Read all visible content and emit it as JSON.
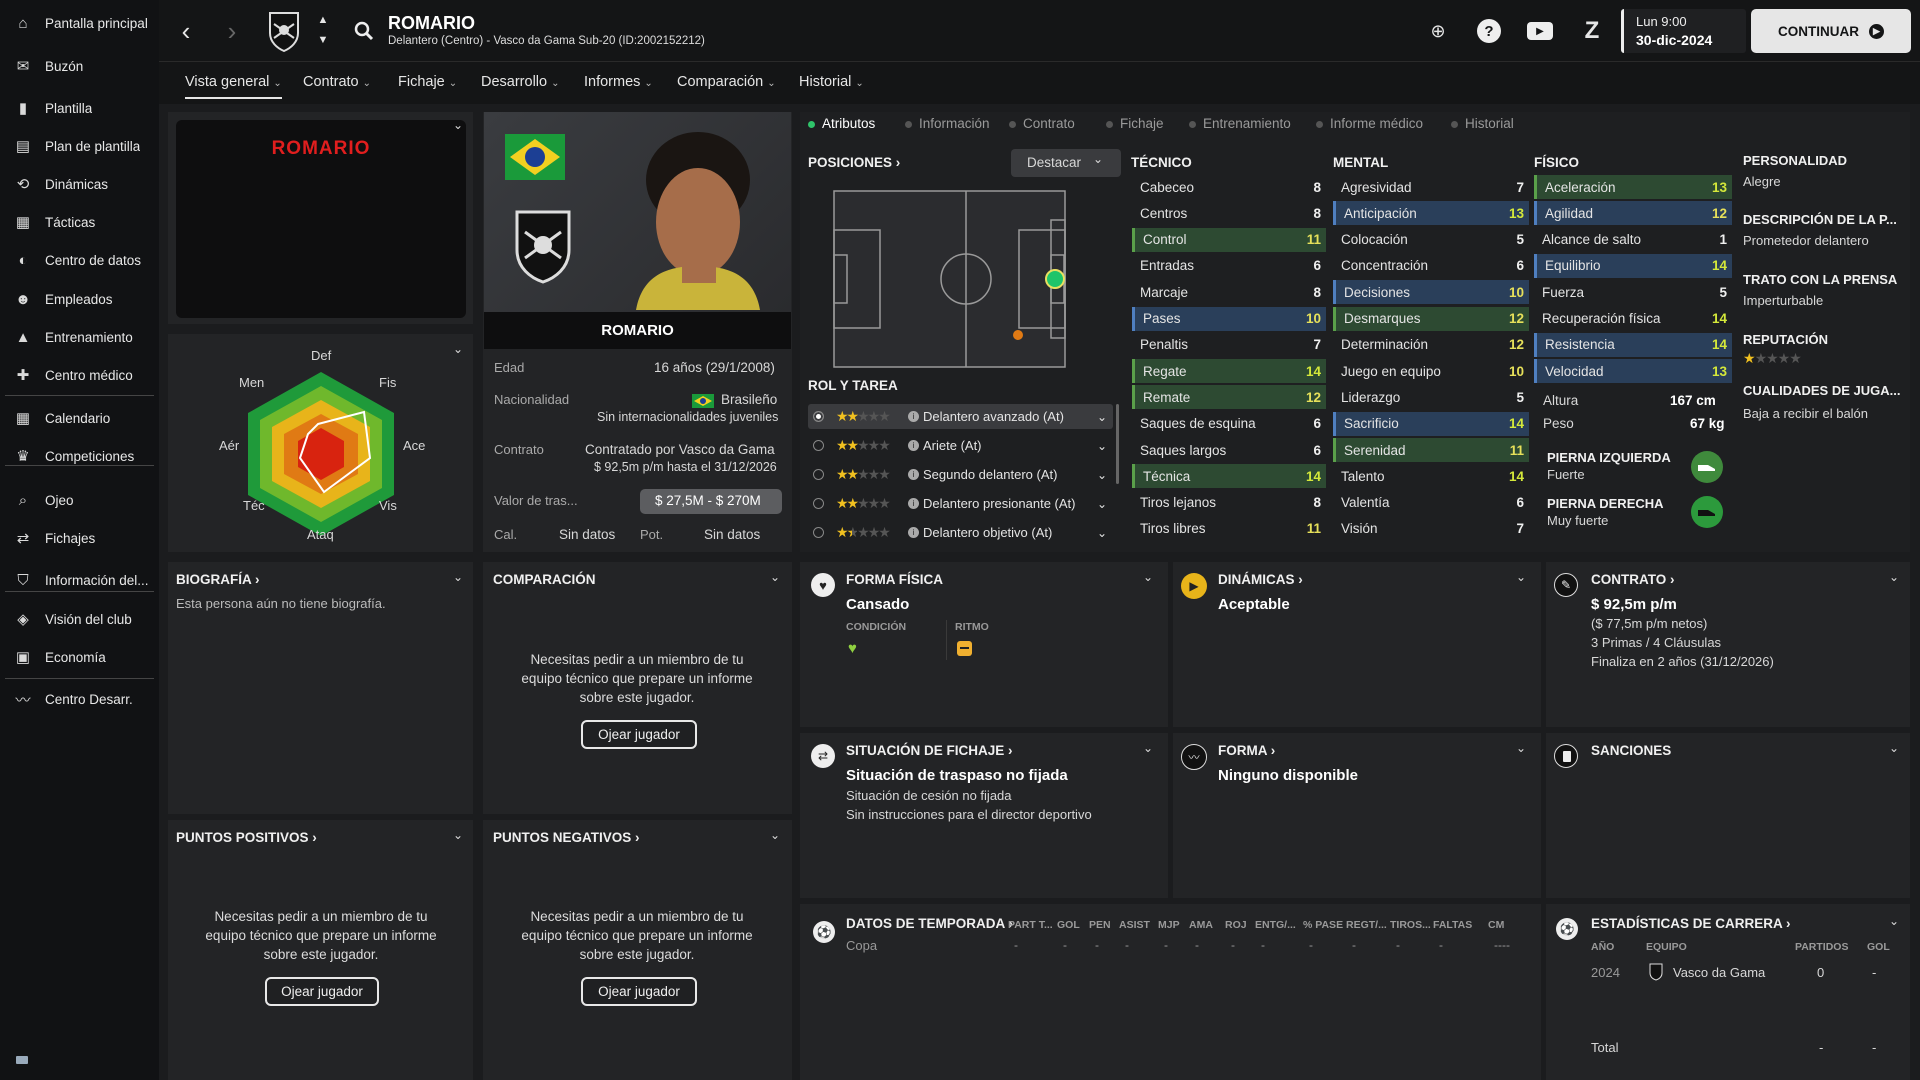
{
  "sidebar": {
    "items": [
      {
        "label": "Pantalla principal",
        "icon": "home-icon"
      },
      {
        "label": "Buzón",
        "icon": "inbox-icon"
      },
      {
        "label": "Plantilla",
        "icon": "squad-icon"
      },
      {
        "label": "Plan de plantilla",
        "icon": "clipboard-icon"
      },
      {
        "label": "Dinámicas",
        "icon": "dynamics-icon"
      },
      {
        "label": "Tácticas",
        "icon": "tactics-icon"
      },
      {
        "label": "Centro de datos",
        "icon": "data-icon"
      },
      {
        "label": "Empleados",
        "icon": "staff-icon"
      },
      {
        "label": "Entrenamiento",
        "icon": "training-icon"
      },
      {
        "label": "Centro médico",
        "icon": "medical-icon"
      },
      {
        "label": "Calendario",
        "icon": "calendar-icon"
      },
      {
        "label": "Competiciones",
        "icon": "trophy-icon"
      },
      {
        "label": "Ojeo",
        "icon": "scouting-icon"
      },
      {
        "label": "Fichajes",
        "icon": "transfers-icon"
      },
      {
        "label": "Información del...",
        "icon": "club-info-icon"
      },
      {
        "label": "Visión del club",
        "icon": "club-vision-icon"
      },
      {
        "label": "Economía",
        "icon": "finance-icon"
      },
      {
        "label": "Centro Desarr.",
        "icon": "development-icon"
      }
    ]
  },
  "header": {
    "name": "ROMARIO",
    "subtitle": "Delantero (Centro) - Vasco da Gama Sub-20 (ID:2002152212)",
    "date_line1": "Lun 9:00",
    "date_line2": "30-dic-2024",
    "continue_label": "CONTINUAR"
  },
  "subnav": [
    "Vista general",
    "Contrato",
    "Fichaje",
    "Desarrollo",
    "Informes",
    "Comparación",
    "Historial"
  ],
  "left": {
    "kit_name": "ROMARIO",
    "radar_labels": [
      "Def",
      "Fis",
      "Ace",
      "Vis",
      "Ataq",
      "Téc",
      "Aér",
      "Men"
    ]
  },
  "profile": {
    "name": "ROMARIO",
    "age_label": "Edad",
    "age": "16 años (29/1/2008)",
    "nat_label": "Nacionalidad",
    "nat": "Brasileño",
    "nat_sub": "Sin internacionalidades juveniles",
    "contract_label": "Contrato",
    "contract1": "Contratado por Vasco da Gama",
    "contract2": "$ 92,5m p/m hasta el 31/12/2026",
    "value_label": "Valor de tras...",
    "value": "$ 27,5M - $ 270M",
    "cal_label": "Cal.",
    "cal": "Sin datos",
    "pot_label": "Pot.",
    "pot": "Sin datos"
  },
  "tabs2": [
    "Atributos",
    "Información",
    "Contrato",
    "Fichaje",
    "Entrenamiento",
    "Informe médico",
    "Historial"
  ],
  "positions": {
    "title": "POSICIONES",
    "dropdown": "Destacar",
    "role_title": "ROL Y TAREA",
    "roles": [
      {
        "name": "Delantero avanzado (At)",
        "stars": 2
      },
      {
        "name": "Ariete (At)",
        "stars": 2
      },
      {
        "name": "Segundo delantero (At)",
        "stars": 2
      },
      {
        "name": "Delantero presionante (At)",
        "stars": 2
      },
      {
        "name": "Delantero objetivo (At)",
        "stars": 1.5
      }
    ]
  },
  "technical": {
    "title": "TÉCNICO",
    "attrs": [
      {
        "n": "Cabeceo",
        "v": "8"
      },
      {
        "n": "Centros",
        "v": "8"
      },
      {
        "n": "Control",
        "v": "11"
      },
      {
        "n": "Entradas",
        "v": "6"
      },
      {
        "n": "Marcaje",
        "v": "8"
      },
      {
        "n": "Pases",
        "v": "10"
      },
      {
        "n": "Penaltis",
        "v": "7"
      },
      {
        "n": "Regate",
        "v": "14"
      },
      {
        "n": "Remate",
        "v": "12"
      },
      {
        "n": "Saques de esquina",
        "v": "6"
      },
      {
        "n": "Saques largos",
        "v": "6"
      },
      {
        "n": "Técnica",
        "v": "14"
      },
      {
        "n": "Tiros lejanos",
        "v": "8"
      },
      {
        "n": "Tiros libres",
        "v": "11"
      }
    ]
  },
  "mental": {
    "title": "MENTAL",
    "attrs": [
      {
        "n": "Agresividad",
        "v": "7"
      },
      {
        "n": "Anticipación",
        "v": "13"
      },
      {
        "n": "Colocación",
        "v": "5"
      },
      {
        "n": "Concentración",
        "v": "6"
      },
      {
        "n": "Decisiones",
        "v": "10"
      },
      {
        "n": "Desmarques",
        "v": "12"
      },
      {
        "n": "Determinación",
        "v": "12"
      },
      {
        "n": "Juego en equipo",
        "v": "10"
      },
      {
        "n": "Liderazgo",
        "v": "5"
      },
      {
        "n": "Sacrificio",
        "v": "14"
      },
      {
        "n": "Serenidad",
        "v": "11"
      },
      {
        "n": "Talento",
        "v": "14"
      },
      {
        "n": "Valentía",
        "v": "6"
      },
      {
        "n": "Visión",
        "v": "7"
      }
    ]
  },
  "physical": {
    "title": "FÍSICO",
    "attrs": [
      {
        "n": "Aceleración",
        "v": "13"
      },
      {
        "n": "Agilidad",
        "v": "12"
      },
      {
        "n": "Alcance de salto",
        "v": "1"
      },
      {
        "n": "Equilibrio",
        "v": "14"
      },
      {
        "n": "Fuerza",
        "v": "5"
      },
      {
        "n": "Recuperación física",
        "v": "14"
      },
      {
        "n": "Resistencia",
        "v": "14"
      },
      {
        "n": "Velocidad",
        "v": "13"
      }
    ],
    "height_label": "Altura",
    "height": "167 cm",
    "weight_label": "Peso",
    "weight": "67 kg",
    "left_foot_label": "PIERNA IZQUIERDA",
    "left_foot": "Fuerte",
    "right_foot_label": "PIERNA DERECHA",
    "right_foot": "Muy fuerte"
  },
  "personality": {
    "title": "PERSONALIDAD",
    "value": "Alegre",
    "desc_title": "DESCRIPCIÓN DE LA P...",
    "desc": "Prometedor delantero",
    "press_title": "TRATO CON LA PRENSA",
    "press": "Imperturbable",
    "rep_title": "REPUTACIÓN",
    "qual_title": "CUALIDADES DE JUGA...",
    "qual": "Baja a recibir el balón"
  },
  "bio": {
    "title": "BIOGRAFÍA",
    "text": "Esta persona aún no tiene biografía."
  },
  "comparison": {
    "title": "COMPARACIÓN",
    "text": "Necesitas pedir a un miembro de tu equipo técnico que prepare un informe sobre este jugador.",
    "button": "Ojear jugador"
  },
  "fitness": {
    "title": "FORMA FÍSICA",
    "value": "Cansado",
    "cond": "CONDICIÓN",
    "rhythm": "RITMO"
  },
  "dynamics": {
    "title": "DINÁMICAS",
    "value": "Aceptable"
  },
  "contract": {
    "title": "CONTRATO",
    "wage": "$ 92,5m p/m",
    "net": "($ 77,5m p/m netos)",
    "bonus": "3 Primas / 4 Cláusulas",
    "end": "Finaliza en 2 años (31/12/2026)"
  },
  "transfer": {
    "title": "SITUACIÓN DE FICHAJE",
    "value": "Situación de traspaso no fijada",
    "l1": "Situación de cesión no fijada",
    "l2": "Sin instrucciones para el director deportivo"
  },
  "form": {
    "title": "FORMA",
    "value": "Ninguno disponible"
  },
  "sanctions": {
    "title": "SANCIONES"
  },
  "positives": {
    "title": "PUNTOS POSITIVOS",
    "text": "Necesitas pedir a un miembro de tu equipo técnico que prepare un informe sobre este jugador.",
    "button": "Ojear jugador"
  },
  "negatives": {
    "title": "PUNTOS NEGATIVOS",
    "text": "Necesitas pedir a un miembro de tu equipo técnico que prepare un informe sobre este jugador.",
    "button": "Ojear jugador"
  },
  "season": {
    "title": "DATOS DE TEMPORADA",
    "cols": [
      "PART T...",
      "GOL",
      "PEN",
      "ASIST",
      "MJP",
      "AMA",
      "ROJ",
      "ENTG/...",
      "% PASE",
      "REGT/...",
      "TIROS...",
      "FALTAS",
      "CM"
    ],
    "row_label": "Copa",
    "row": [
      "-",
      "-",
      "-",
      "-",
      "-",
      "-",
      "-",
      "-",
      "-",
      "-",
      "-",
      "-",
      "----"
    ]
  },
  "career": {
    "title": "ESTADÍSTICAS DE CARRERA",
    "cols": [
      "AÑO",
      "EQUIPO",
      "PARTIDOS",
      "GOL"
    ],
    "row": {
      "year": "2024",
      "team": "Vasco da Gama",
      "apps": "0",
      "goals": "-"
    },
    "total_label": "Total",
    "total_apps": "-",
    "total_goals": "-"
  }
}
